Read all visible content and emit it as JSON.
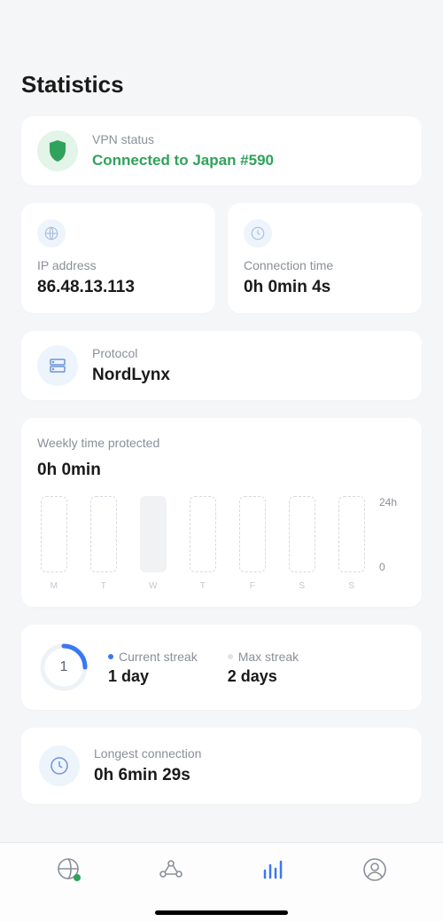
{
  "page_title": "Statistics",
  "vpn_status": {
    "label": "VPN status",
    "text": "Connected to Japan #590"
  },
  "ip": {
    "label": "IP address",
    "value": "86.48.13.113"
  },
  "conn_time": {
    "label": "Connection time",
    "value": "0h 0min 4s"
  },
  "protocol": {
    "label": "Protocol",
    "value": "NordLynx"
  },
  "weekly": {
    "title": "Weekly time protected",
    "value": "0h 0min",
    "y_top": "24h",
    "y_bottom": "0"
  },
  "chart_data": {
    "type": "bar",
    "categories": [
      "M",
      "T",
      "W",
      "T",
      "F",
      "S",
      "S"
    ],
    "values": [
      0,
      0,
      1,
      0,
      0,
      0,
      0
    ],
    "ylim": [
      0,
      24
    ],
    "ylabel": "hours",
    "title": "Weekly time protected",
    "highlight_index": 2
  },
  "streak": {
    "ring_value": "1",
    "current_label": "Current streak",
    "current_value": "1 day",
    "max_label": "Max streak",
    "max_value": "2 days"
  },
  "longest": {
    "label": "Longest connection",
    "value": "0h 6min 29s"
  },
  "nav": {
    "items": [
      "globe",
      "mesh",
      "stats",
      "profile"
    ],
    "active_index": 2
  }
}
